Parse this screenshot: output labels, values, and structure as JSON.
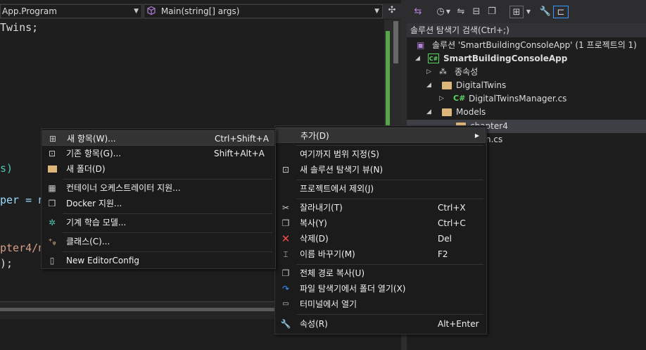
{
  "editor": {
    "nav_project": "App.Program",
    "nav_member": "Main(string[] args)",
    "code_lines": [
      "Twins;",
      "s)",
      "per = n",
      "pter4/n",
      ");"
    ]
  },
  "solution_explorer": {
    "search_placeholder": "솔루션 탐색기 검색(Ctrl+;)",
    "tree": [
      {
        "label": "솔루션 'SmartBuildingConsoleApp' (1 프로젝트의 1)",
        "icon": "solution-icon"
      },
      {
        "label": "SmartBuildingConsoleApp",
        "icon": "csharp-project-icon"
      },
      {
        "label": "종속성",
        "icon": "dependencies-icon"
      },
      {
        "label": "DigitalTwins",
        "icon": "folder-icon"
      },
      {
        "label": "DigitalTwinsManager.cs",
        "icon": "csharp-file-icon"
      },
      {
        "label": "Models",
        "icon": "folder-icon"
      },
      {
        "label": "chapter4",
        "icon": "folder-icon"
      },
      {
        "label": "n.cs",
        "icon": "csharp-file-icon"
      }
    ]
  },
  "context_menu": {
    "items": [
      {
        "label": "추가(D)",
        "shortcut": "",
        "icon": "",
        "submenu": true
      },
      {
        "label": "여기까지 범위 지정(S)",
        "shortcut": "",
        "icon": ""
      },
      {
        "label": "새 솔루션 탐색기 뷰(N)",
        "shortcut": "",
        "icon": "new-view-icon"
      },
      {
        "label": "프로젝트에서 제외(J)",
        "shortcut": "",
        "icon": ""
      },
      {
        "label": "잘라내기(T)",
        "shortcut": "Ctrl+X",
        "icon": "scissors-icon"
      },
      {
        "label": "복사(Y)",
        "shortcut": "Ctrl+C",
        "icon": "copy-icon"
      },
      {
        "label": "삭제(D)",
        "shortcut": "Del",
        "icon": "delete-x-icon"
      },
      {
        "label": "이름 바꾸기(M)",
        "shortcut": "F2",
        "icon": "rename-icon"
      },
      {
        "label": "전체 경로 복사(U)",
        "shortcut": "",
        "icon": "copy-path-icon"
      },
      {
        "label": "파일 탐색기에서 폴더 열기(X)",
        "shortcut": "",
        "icon": "refresh-arrow-icon"
      },
      {
        "label": "터미널에서 열기",
        "shortcut": "",
        "icon": "terminal-icon"
      },
      {
        "label": "속성(R)",
        "shortcut": "Alt+Enter",
        "icon": "wrench-icon"
      }
    ]
  },
  "add_submenu": {
    "items": [
      {
        "label": "새 항목(W)...",
        "shortcut": "Ctrl+Shift+A",
        "icon": "new-item-icon"
      },
      {
        "label": "기존 항목(G)...",
        "shortcut": "Shift+Alt+A",
        "icon": "existing-item-icon"
      },
      {
        "label": "새 폴더(D)",
        "shortcut": "",
        "icon": "new-folder-icon"
      },
      {
        "label": "컨테이너 오케스트레이터 지원...",
        "shortcut": "",
        "icon": "container-icon"
      },
      {
        "label": "Docker 지원...",
        "shortcut": "",
        "icon": "docker-icon"
      },
      {
        "label": "기계 학습 모델...",
        "shortcut": "",
        "icon": "ml-model-icon"
      },
      {
        "label": "클래스(C)...",
        "shortcut": "",
        "icon": "class-icon"
      },
      {
        "label": "New EditorConfig",
        "shortcut": "",
        "icon": "editorconfig-icon"
      }
    ]
  }
}
